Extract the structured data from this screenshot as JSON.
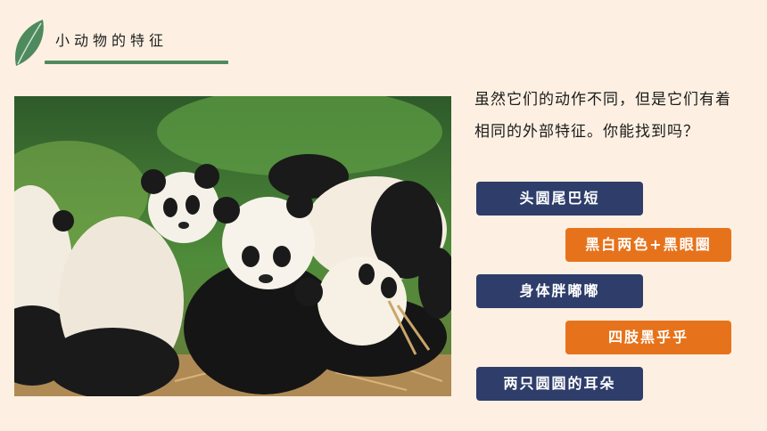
{
  "header": {
    "title": "小动物的特征"
  },
  "question": "虽然它们的动作不同，但是它们有着相同的外部特征。你能找到吗？",
  "answers": [
    {
      "label": "头圆尾巴短",
      "color": "#2e3d6a"
    },
    {
      "label": "黑白两色+黑眼圈",
      "color": "#e6731c"
    },
    {
      "label": "身体胖嘟嘟",
      "color": "#2e3d6a"
    },
    {
      "label": "四肢黑乎乎",
      "color": "#e6731c"
    },
    {
      "label": "两只圆圆的耳朵",
      "color": "#2e3d6a"
    }
  ],
  "colors": {
    "background": "#fdf0e2",
    "accent_green": "#4e8a5e",
    "navy": "#2e3d6a",
    "orange": "#e6731c"
  },
  "icons": {
    "header_icon": "leaf-icon"
  },
  "image": {
    "subject": "giant-pandas-photo"
  }
}
